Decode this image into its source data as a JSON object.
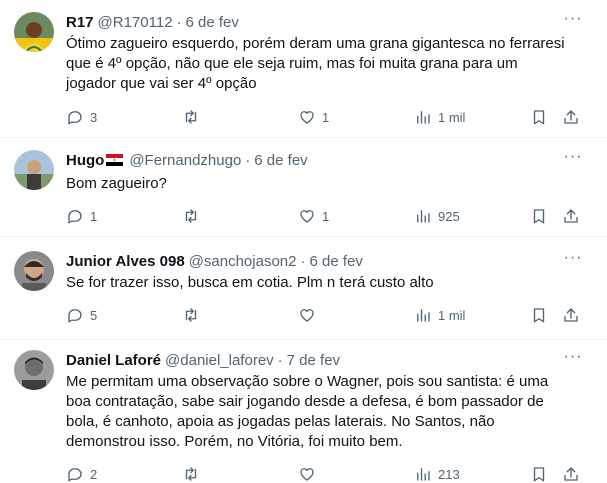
{
  "tweets": [
    {
      "name": "R17",
      "handle": "@R170112",
      "dot": "·",
      "date": "6 de fev",
      "text": "Ótimo zagueiro esquerdo, porém deram uma grana gigantesca no ferraresi que é 4º opção, não que ele seja ruim, mas foi muita grana para um jogador que vai ser 4º opção",
      "replies": "3",
      "retweets": "",
      "likes": "1",
      "views": "1 mil"
    },
    {
      "name": "Hugo",
      "handle": "@Fernandzhugo",
      "dot": "·",
      "date": "6 de fev",
      "text": "Bom zagueiro?",
      "replies": "1",
      "retweets": "",
      "likes": "1",
      "views": "925"
    },
    {
      "name": "Junior Alves 098",
      "handle": "@sanchojason2",
      "dot": "·",
      "date": "6 de fev",
      "text": "Se for trazer isso, busca em cotia. Plm n terá custo alto",
      "replies": "5",
      "retweets": "",
      "likes": "",
      "views": "1 mil"
    },
    {
      "name": "Daniel Laforé",
      "handle": "@daniel_laforev",
      "dot": "·",
      "date": "7 de fev",
      "text": "Me permitam uma observação sobre o Wagner, pois sou santista: é uma boa contratação, sabe sair jogando desde a defesa, é bom passador de bola, é canhoto, apoia as jogadas pelas laterais. No Santos, não demonstrou isso. Porém, no Vitória, foi muito bem.",
      "replies": "2",
      "retweets": "",
      "likes": "",
      "views": "213"
    }
  ],
  "more_glyph": "···",
  "colors": {
    "text": "#0f1419",
    "secondary": "#536471",
    "divider": "#eff3f4",
    "flag_red": "#ce1126",
    "flag_black": "#000000"
  },
  "icons": [
    "reply-icon",
    "retweet-icon",
    "heart-icon",
    "views-icon",
    "bookmark-icon",
    "share-icon",
    "more-icon",
    "egypt-flag-icon"
  ]
}
